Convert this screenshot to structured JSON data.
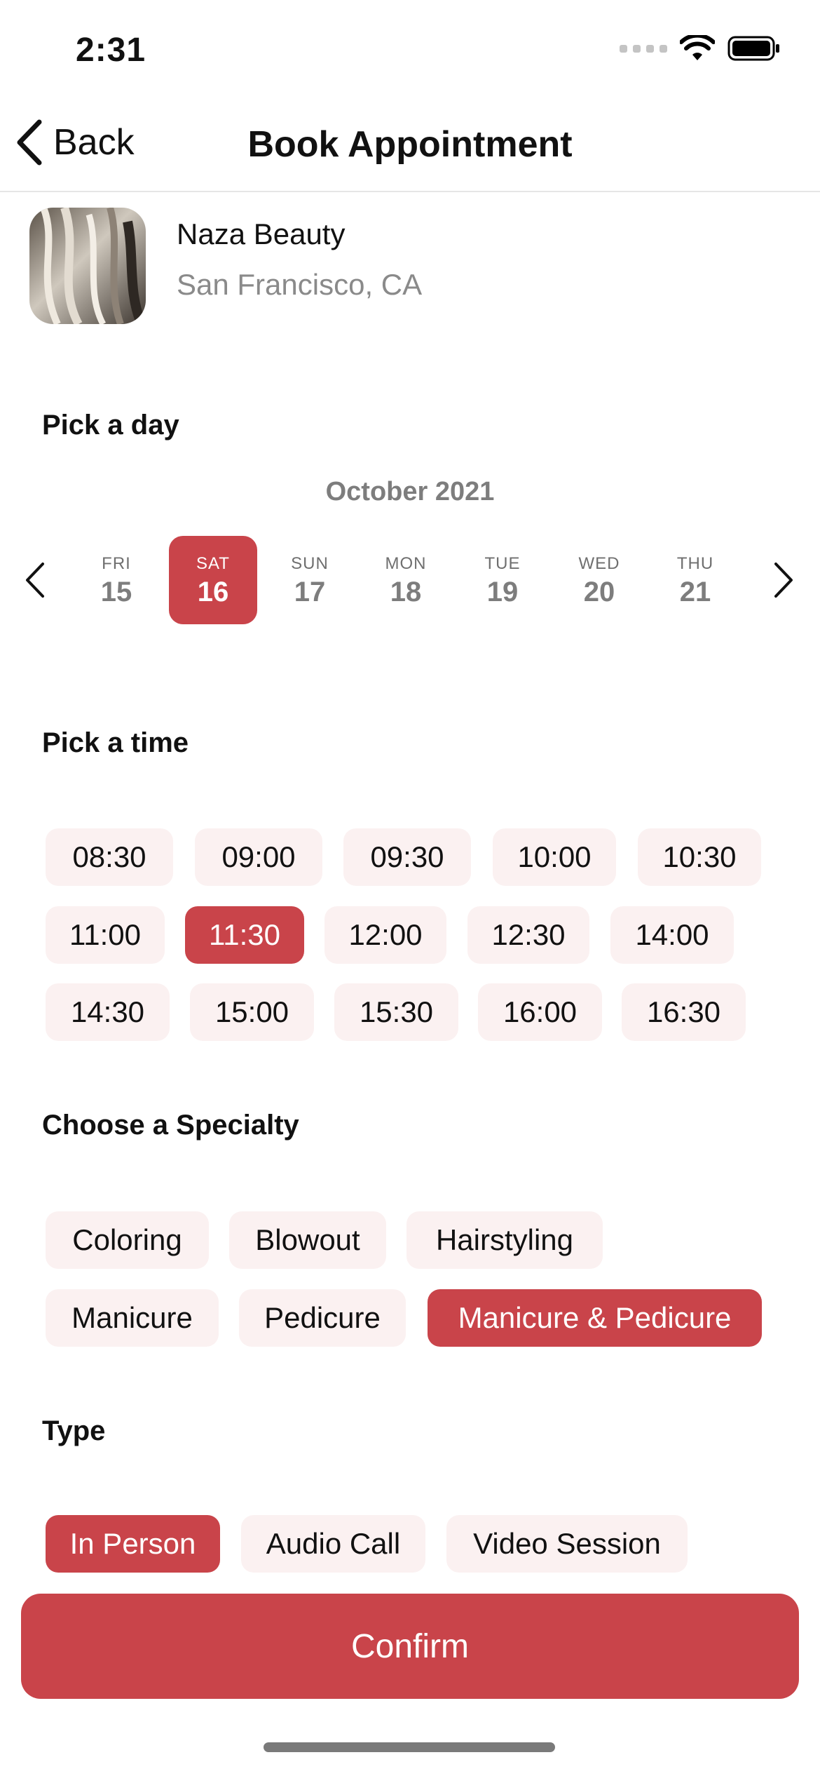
{
  "status_bar": {
    "time": "2:31"
  },
  "nav": {
    "back_label": "Back",
    "title": "Book Appointment"
  },
  "salon": {
    "name": "Naza Beauty",
    "location": "San Francisco, CA"
  },
  "sections": {
    "day": "Pick a day",
    "time": "Pick a time",
    "specialty": "Choose a Specialty",
    "type": "Type"
  },
  "calendar": {
    "month": "October 2021",
    "days": [
      {
        "dow": "FRI",
        "num": "15",
        "selected": false
      },
      {
        "dow": "SAT",
        "num": "16",
        "selected": true
      },
      {
        "dow": "SUN",
        "num": "17",
        "selected": false
      },
      {
        "dow": "MON",
        "num": "18",
        "selected": false
      },
      {
        "dow": "TUE",
        "num": "19",
        "selected": false
      },
      {
        "dow": "WED",
        "num": "20",
        "selected": false
      },
      {
        "dow": "THU",
        "num": "21",
        "selected": false
      }
    ]
  },
  "time_slots": [
    {
      "label": "08:30",
      "selected": false
    },
    {
      "label": "09:00",
      "selected": false
    },
    {
      "label": "09:30",
      "selected": false
    },
    {
      "label": "10:00",
      "selected": false
    },
    {
      "label": "10:30",
      "selected": false
    },
    {
      "label": "11:00",
      "selected": false
    },
    {
      "label": "11:30",
      "selected": true
    },
    {
      "label": "12:00",
      "selected": false
    },
    {
      "label": "12:30",
      "selected": false
    },
    {
      "label": "14:00",
      "selected": false
    },
    {
      "label": "14:30",
      "selected": false
    },
    {
      "label": "15:00",
      "selected": false
    },
    {
      "label": "15:30",
      "selected": false
    },
    {
      "label": "16:00",
      "selected": false
    },
    {
      "label": "16:30",
      "selected": false
    }
  ],
  "specialties": [
    {
      "label": "Coloring",
      "selected": false
    },
    {
      "label": "Blowout",
      "selected": false
    },
    {
      "label": "Hairstyling",
      "selected": false
    },
    {
      "label": "Manicure",
      "selected": false
    },
    {
      "label": "Pedicure",
      "selected": false
    },
    {
      "label": "Manicure & Pedicure",
      "selected": true
    }
  ],
  "types": [
    {
      "label": "In Person",
      "selected": true
    },
    {
      "label": "Audio Call",
      "selected": false
    },
    {
      "label": "Video Session",
      "selected": false
    }
  ],
  "confirm_label": "Confirm",
  "colors": {
    "accent": "#c9444a",
    "chip_bg": "#fbf1f1",
    "muted_text": "#7d7d7d"
  }
}
